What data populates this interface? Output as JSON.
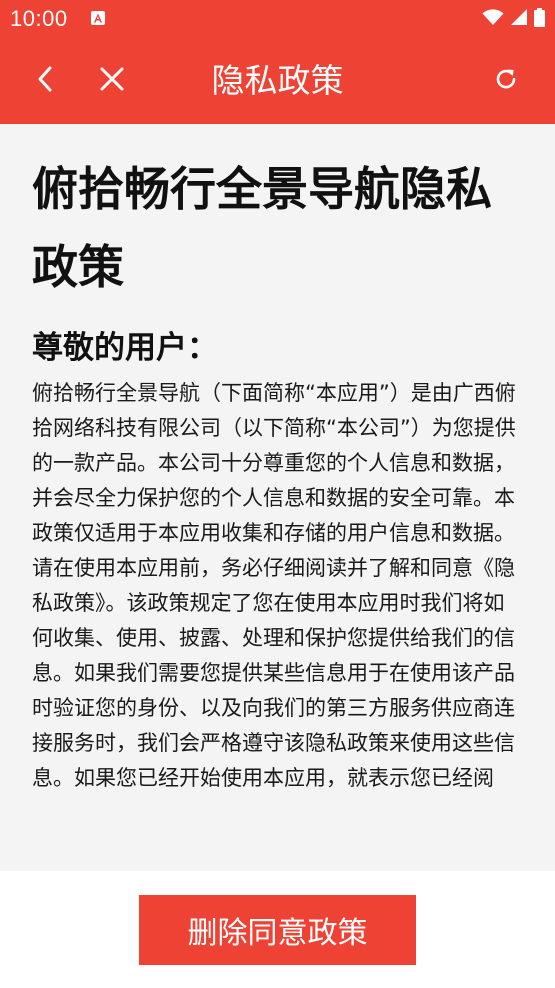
{
  "status_bar": {
    "time": "10:00",
    "notification_icon": "a-box-icon",
    "wifi_icon": "wifi-icon",
    "signal_icon": "signal-icon",
    "battery_icon": "battery-icon"
  },
  "nav": {
    "title": "隐私政策",
    "back_icon": "chevron-left-icon",
    "close_icon": "close-icon",
    "refresh_icon": "refresh-icon"
  },
  "document": {
    "title": "俯拾畅行全景导航隐私政策",
    "greeting": "尊敬的用户：",
    "paragraphs": [
      "俯拾畅行全景导航（下面简称“本应用”）是由广西俯拾网络科技有限公司（以下简称“本公司”）为您提供的一款产品。本公司十分尊重您的个人信息和数据，并会尽全力保护您的个人信息和数据的安全可靠。本政策仅适用于本应用收集和存储的用户信息和数据。",
      "请在使用本应用前，务必仔细阅读并了解和同意《隐私政策》。该政策规定了您在使用本应用时我们将如何收集、使用、披露、处理和保护您提供给我们的信息。如果我们需要您提供某些信息用于在使用该产品时验证您的身份、以及向我们的第三方服务供应商连接服务时，我们会严格遵守该隐私政策来使用这些信息。如果您已经开始使用本应用，就表示您已经阅"
    ]
  },
  "footer": {
    "delete_button_label": "删除同意政策"
  },
  "colors": {
    "accent": "#ee4234",
    "background": "#f4f4f4",
    "text": "#111111"
  }
}
